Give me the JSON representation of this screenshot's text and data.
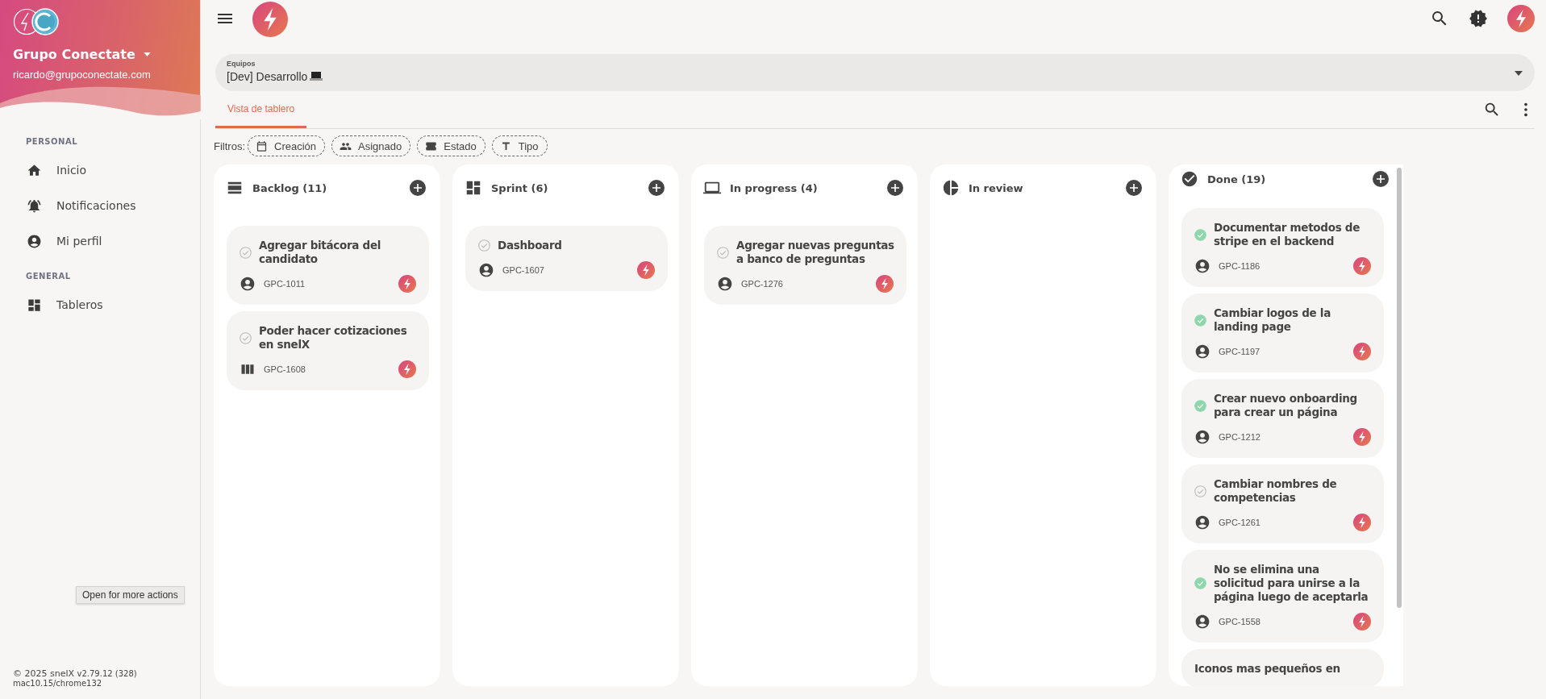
{
  "sidebar": {
    "org": "Grupo Conectate",
    "email": "ricardo@grupoconectate.com",
    "sections": [
      {
        "heading": "PERSONAL",
        "items": [
          {
            "label": "Inicio",
            "kind": "home"
          },
          {
            "label": "Notificaciones",
            "kind": "bell"
          },
          {
            "label": "Mi perfil",
            "kind": "profile"
          }
        ]
      },
      {
        "heading": "GENERAL",
        "items": [
          {
            "label": "Tableros",
            "kind": "dashboard"
          }
        ]
      }
    ],
    "tooltip": "Open for more actions",
    "footer": {
      "copyright": "© 2025 snelX",
      "version": "v2.79.12 (328)",
      "platform": "mac10.15/chrome132"
    }
  },
  "team_select": {
    "label": "Equipos",
    "value": "[Dev] Desarrollo"
  },
  "tabs": [
    {
      "label": "Vista de tablero",
      "selected": true
    }
  ],
  "filters": {
    "label": "Filtros:",
    "chips": [
      {
        "label": "Creación",
        "kind": "calendar"
      },
      {
        "label": "Asignado",
        "kind": "people"
      },
      {
        "label": "Estado",
        "kind": "ticket"
      },
      {
        "label": "Tipo",
        "kind": "text"
      }
    ]
  },
  "columns": [
    {
      "title": "Backlog (11)",
      "kind": "backlog",
      "cards": [
        {
          "title": "Agregar bitácora del candidato",
          "done": false,
          "id": "GPC-1011",
          "kind": "user"
        },
        {
          "title": "Poder hacer cotizaciones en snelX",
          "done": false,
          "id": "GPC-1608",
          "kind": "bars"
        }
      ]
    },
    {
      "title": "Sprint (6)",
      "kind": "sprint",
      "cards": [
        {
          "title": "Dashboard",
          "done": false,
          "id": "GPC-1607",
          "kind": "user"
        }
      ]
    },
    {
      "title": "In progress (4)",
      "kind": "progress",
      "cards": [
        {
          "title": "Agregar nuevas preguntas a banco de preguntas",
          "done": false,
          "id": "GPC-1276",
          "kind": "user"
        }
      ]
    },
    {
      "title": "In review",
      "kind": "review"
    },
    {
      "title": "Done (19)",
      "kind": "done",
      "cards": [
        {
          "title": "Documentar metodos de stripe en el backend",
          "done": true,
          "id": "GPC-1186",
          "kind": "user"
        },
        {
          "title": "Cambiar logos de la landing page",
          "done": true,
          "id": "GPC-1197",
          "kind": "user"
        },
        {
          "title": "Crear nuevo onboarding para crear un página",
          "done": true,
          "id": "GPC-1212",
          "kind": "user"
        },
        {
          "title": "Cambiar nombres de competencias",
          "done": false,
          "id": "GPC-1261",
          "kind": "user"
        },
        {
          "title": "No se elimina una solicitud para unirse a la página luego de aceptarla",
          "done": true,
          "id": "GPC-1558",
          "kind": "user"
        },
        {
          "title": "Iconos mas pequeños en"
        }
      ]
    }
  ]
}
